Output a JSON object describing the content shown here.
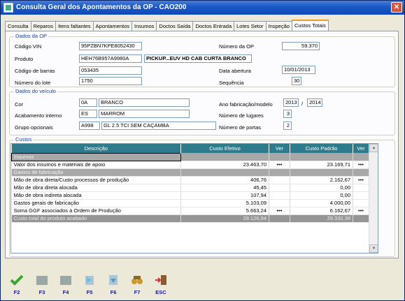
{
  "window": {
    "title": "Consulta Geral dos Apontamentos da OP - CAO200",
    "close_label": "✕"
  },
  "tabs": [
    {
      "label": "Consulta"
    },
    {
      "label": "Reparos"
    },
    {
      "label": "Itens faltantes"
    },
    {
      "label": "Apontamentos"
    },
    {
      "label": "Insumos"
    },
    {
      "label": "Doctos Saída"
    },
    {
      "label": "Doctos Entrada"
    },
    {
      "label": "Lotes Setor"
    },
    {
      "label": "Inspeção"
    },
    {
      "label": "Custos Totais"
    }
  ],
  "dados_op": {
    "group_label": "Dados da OP",
    "codigo_vin_label": "Código VIN",
    "codigo_vin": "95PZBN7KPE8052430",
    "produto_label": "Produto",
    "produto_code": "HEH76B957A9980A",
    "produto_desc": "PICKUP...EUV HD CAB CURTA BRANCO",
    "codigo_barras_label": "Código de barras",
    "codigo_barras": "053435",
    "numero_lote_label": "Número do lote",
    "numero_lote": "1750",
    "numero_op_label": "Número da OP",
    "numero_op": "59.370",
    "data_abertura_label": "Data abertura",
    "data_abertura": "10/01/2013",
    "sequencia_label": "Sequência",
    "sequencia": "30"
  },
  "dados_veiculo": {
    "group_label": "Dados do veículo",
    "cor_label": "Cor",
    "cor_code": "0A",
    "cor_desc": "BRANCO",
    "acabamento_label": "Acabamento interno",
    "acabamento_code": "ES",
    "acabamento_desc": "MARROM",
    "grupo_label": "Grupo opcionais",
    "grupo_code": "A998",
    "grupo_desc": "GL 2.5 TCI SEM CAÇAMBA",
    "ano_label": "Ano fabricação/modelo",
    "ano_fab": "2013",
    "ano_sep": "/",
    "ano_modelo": "2014",
    "lugares_label": "Número de lugares",
    "lugares": "3",
    "portas_label": "Número de portas",
    "portas": "2"
  },
  "custos": {
    "group_label": "Custos",
    "headers": {
      "descricao": "Descrição",
      "custo_efetivo": "Custo Efetivo",
      "ver1": "Ver",
      "custo_padrao": "Custo Padrão",
      "ver2": "Ver"
    },
    "rows": [
      {
        "type": "section-sel",
        "desc": "Insumos",
        "efetivo": "",
        "ver1": "",
        "padrao": "",
        "ver2": ""
      },
      {
        "type": "row",
        "desc": "Valor dos insumos e materiais de apoio",
        "efetivo": "23.463,70",
        "ver1": "•••",
        "padrao": "23.169,71",
        "ver2": "•••"
      },
      {
        "type": "section",
        "desc": "Gastos de fabricação",
        "efetivo": "",
        "ver1": "",
        "padrao": "",
        "ver2": ""
      },
      {
        "type": "row",
        "desc": "Mão de obra direta/Custo processos de produção",
        "efetivo": "406,76",
        "ver1": "",
        "padrao": "2.162,67",
        "ver2": "•••"
      },
      {
        "type": "row",
        "desc": "Mão de obra direta alocada",
        "efetivo": "45,45",
        "ver1": "",
        "padrao": "0,00",
        "ver2": ""
      },
      {
        "type": "row",
        "desc": "Mão de obra indireta alocada",
        "efetivo": "107,94",
        "ver1": "",
        "padrao": "0,00",
        "ver2": ""
      },
      {
        "type": "row",
        "desc": "Gastos gerais de fabricação",
        "efetivo": "5.103,09",
        "ver1": "",
        "padrao": "4.000,00",
        "ver2": ""
      },
      {
        "type": "row",
        "desc": "Soma GGF associados à Ordem de Produção",
        "efetivo": "5.663,24",
        "ver1": "•••",
        "padrao": "6.162,67",
        "ver2": "•••"
      },
      {
        "type": "total",
        "desc": "Custo total do produto acabado",
        "efetivo": "29.126,94",
        "ver1": "",
        "padrao": "29.332,38",
        "ver2": ""
      }
    ]
  },
  "toolbar": [
    {
      "key": "F2",
      "icon": "checkmark-icon",
      "color": "#3aa63a"
    },
    {
      "key": "F3",
      "icon": "blank-icon",
      "color": "#9aa7a7"
    },
    {
      "key": "F4",
      "icon": "blank-icon",
      "color": "#9aa7a7"
    },
    {
      "key": "F5",
      "icon": "arrow-icon",
      "color": "#7ab8d8"
    },
    {
      "key": "F6",
      "icon": "arrow-down-icon",
      "color": "#7ab8d8"
    },
    {
      "key": "F7",
      "icon": "binoculars-icon",
      "color": "#c89a30"
    },
    {
      "key": "ESC",
      "icon": "exit-door-icon",
      "color": "#d03030"
    }
  ]
}
